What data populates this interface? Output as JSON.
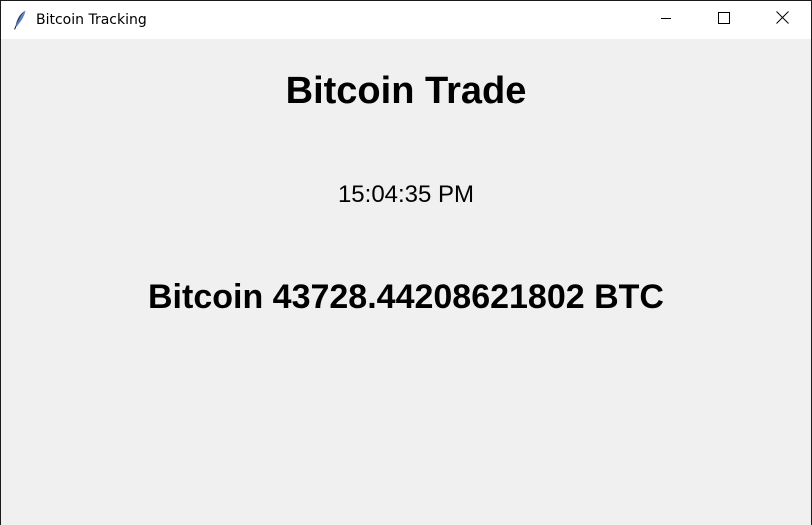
{
  "window": {
    "title": "Bitcoin Tracking",
    "app_icon": "feather-icon",
    "controls": {
      "minimize_icon": "minimize-icon",
      "maximize_icon": "maximize-icon",
      "close_icon": "close-icon"
    }
  },
  "main": {
    "heading": "Bitcoin Trade",
    "time": "15:04:35 PM",
    "price_text": "Bitcoin 43728.44208621802 BTC"
  },
  "colors": {
    "background": "#f0f0f0",
    "titlebar": "#ffffff",
    "text": "#000000"
  }
}
